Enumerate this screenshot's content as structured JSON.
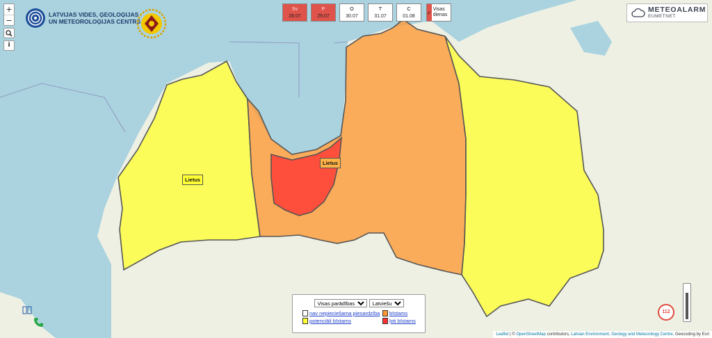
{
  "map": {
    "colors": {
      "sea": "#aad3df",
      "land": "#eef0e4",
      "yellow": "#ffff33",
      "orange": "#ff9933",
      "red": "#ff3333"
    },
    "region_labels": {
      "riga": "Lietus",
      "kurzeme": "Lietus"
    }
  },
  "zoom": {
    "in": "+",
    "out": "−"
  },
  "tools": {
    "search_icon": "search-icon",
    "info_label": "i"
  },
  "logo": {
    "text": "LATVIJAS VIDES, ĢEOLOĢIJAS\nUN METEOROLOĢIJAS CENTRS"
  },
  "days": [
    {
      "name": "Sv",
      "date": "28.07",
      "level": "red"
    },
    {
      "name": "P",
      "date": "29.07",
      "level": "red"
    },
    {
      "name": "O",
      "date": "30.07",
      "level": "none"
    },
    {
      "name": "T",
      "date": "31.07",
      "level": "none"
    },
    {
      "name": "C",
      "date": "01.08",
      "level": "none"
    }
  ],
  "all_days": {
    "label": "Visas dienas",
    "check": "✓"
  },
  "meteoalarm": {
    "title": "METEOALARM",
    "subtitle": "EUMETNET"
  },
  "legend": {
    "phenomenon_select": "Visas parādības",
    "language_select": "Latviešu",
    "items": [
      {
        "label": "nav nepieciešama piesardzība",
        "color": "#ffffff"
      },
      {
        "label": "bīstams",
        "color": "#ff9933"
      },
      {
        "label": "potenciāli bīstams",
        "color": "#ffff33"
      },
      {
        "label": "ļoti bīstams",
        "color": "#ff3333"
      }
    ]
  },
  "emergency": {
    "label": "112"
  },
  "attribution": {
    "leaflet": "Leaflet",
    "osm": "OpenStreetMap",
    "contributors": "contributors,",
    "lvgmc": "Latvian Environment, Geology and Meteorology Centre,",
    "geocoding": "Geocoding by Esri"
  }
}
